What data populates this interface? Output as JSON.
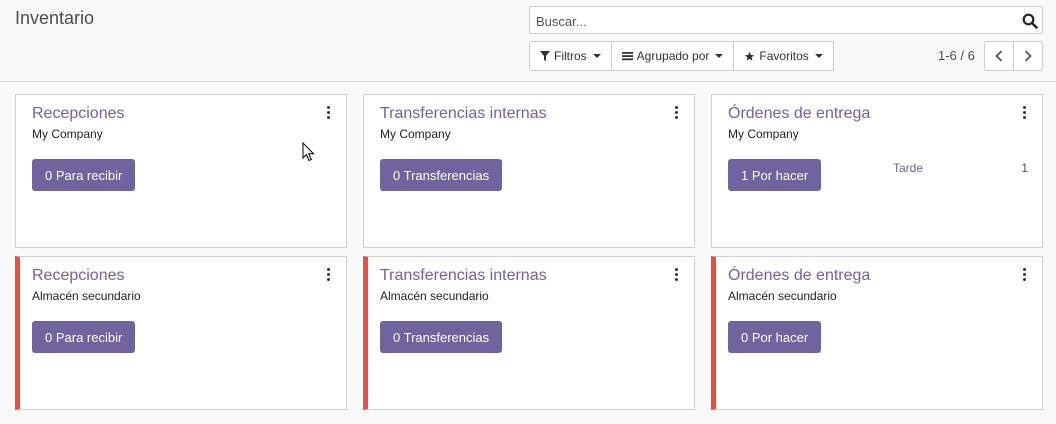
{
  "app": {
    "title": "Inventario"
  },
  "search": {
    "placeholder": "Buscar..."
  },
  "toolbar": {
    "filters_label": "Filtros",
    "group_by_label": "Agrupado por",
    "favorites_label": "Favoritos"
  },
  "pager": {
    "value": "1-6 / 6"
  },
  "icons": {
    "search": "search-icon",
    "filter": "filter-icon",
    "group": "bars-icon",
    "favorite": "star-icon",
    "prev": "chevron-left-icon",
    "next": "chevron-right-icon",
    "menu": "kebab-icon"
  },
  "colors": {
    "accent": "#71639e",
    "warning_stripe": "#f04b4b"
  },
  "cards": [
    {
      "title": "Recepciones",
      "subtitle": "My Company",
      "button": "0 Para recibir"
    },
    {
      "title": "Transferencias internas",
      "subtitle": "My Company",
      "button": "0 Transferencias"
    },
    {
      "title": "Órdenes de entrega",
      "subtitle": "My Company",
      "button": "1 Por hacer",
      "late_label": "Tarde",
      "late_count": "1"
    },
    {
      "title": "Recepciones",
      "subtitle": "Almacén secundario",
      "button": "0 Para recibir"
    },
    {
      "title": "Transferencias internas",
      "subtitle": "Almacén secundario",
      "button": "0 Transferencias"
    },
    {
      "title": "Órdenes de entrega",
      "subtitle": "Almacén secundario",
      "button": "0 Por hacer"
    }
  ]
}
